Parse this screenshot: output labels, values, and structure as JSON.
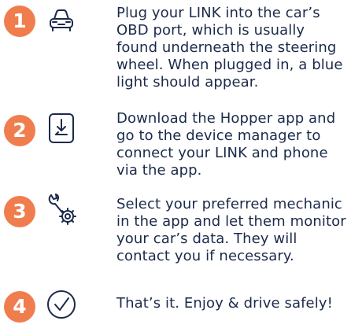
{
  "steps": [
    {
      "number": "1",
      "icon": "car-icon",
      "text": "Plug your LINK into the car’s OBD port, which is usually found underneath the steering wheel. When plugged in, a blue light should appear."
    },
    {
      "number": "2",
      "icon": "phone-download-icon",
      "text": "Download the Hopper app and go to the device manager to connect your LINK and phone via the app."
    },
    {
      "number": "3",
      "icon": "wrench-gear-icon",
      "text": "Select your preferred mechanic in the app and let them monitor your car’s data. They will contact you if necessary."
    },
    {
      "number": "4",
      "icon": "checkmark-icon",
      "text": "That’s it. Enjoy & drive safely!"
    }
  ],
  "colors": {
    "accent": "#f07d4d",
    "text": "#1b2a4a"
  }
}
